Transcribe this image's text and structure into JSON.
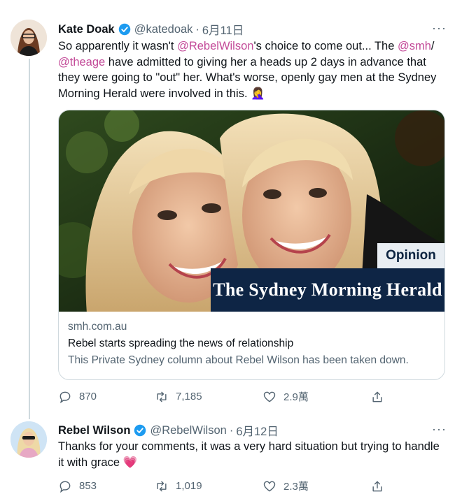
{
  "tweet1": {
    "name": "Kate Doak",
    "handle": "@katedoak",
    "dot": "·",
    "date": "6月11日",
    "more": "···",
    "line1_pre": "So apparently it wasn't ",
    "line1_mention": "@RebelWilson",
    "line1_mid": "'s choice to come out... The ",
    "line1_mention2": "@smh",
    "line1_slash": "/",
    "line2_mention": "@theage",
    "line2_rest": " have admitted to giving her a heads up 2 days in advance that",
    "line3": "they were going to \"out\" her. What's worse, openly gay men at the Sydney",
    "line4": "Morning Herald were involved in this.",
    "emoji": "🤦‍♀️",
    "card": {
      "badge": "Opinion",
      "masthead": "The Sydney Morning Herald",
      "domain": "smh.com.au",
      "title": "Rebel starts spreading the news of relationship",
      "description": "This Private Sydney column about Rebel Wilson has been taken down."
    },
    "stats": {
      "replies": "870",
      "retweets": "7,185",
      "likes": "2.9萬"
    }
  },
  "tweet2": {
    "name": "Rebel Wilson",
    "handle": "@RebelWilson",
    "dot": "·",
    "date": "6月12日",
    "more": "···",
    "line1": "Thanks for your comments, it was a very hard situation but trying to handle",
    "line2": "it with grace",
    "emoji": "💗",
    "stats": {
      "replies": "853",
      "retweets": "1,019",
      "likes": "2.3萬"
    }
  },
  "colors": {
    "mention": "#c34a98",
    "verified": "#1d9bf0",
    "secondary": "#536471",
    "masthead_bg": "#0e2545"
  }
}
